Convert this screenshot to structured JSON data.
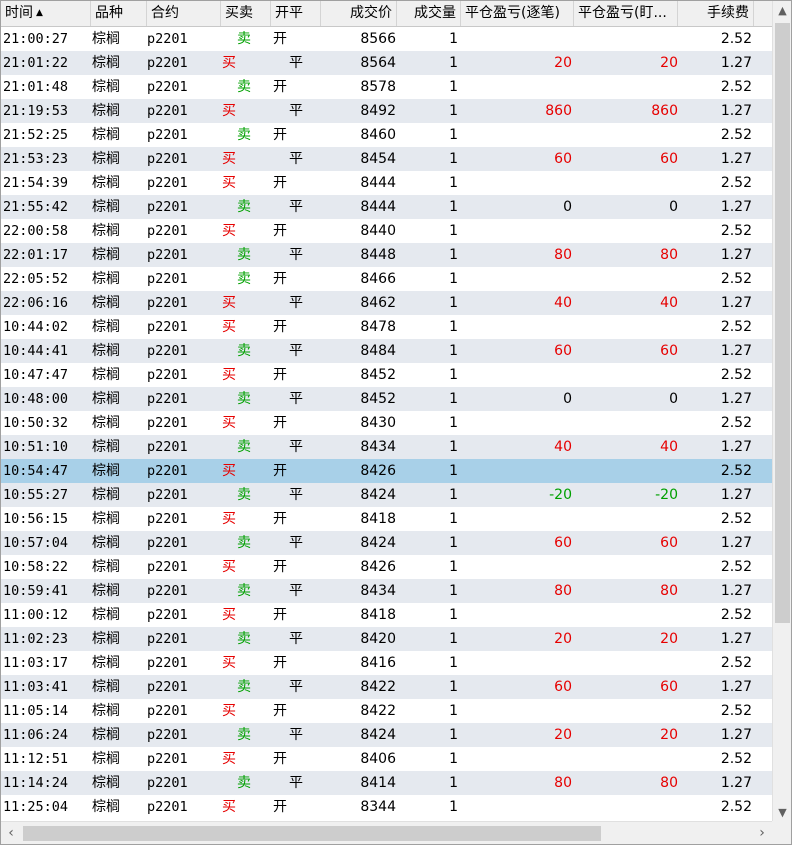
{
  "columns": {
    "time": "时间",
    "variety": "品种",
    "contract": "合约",
    "buysell": "买卖",
    "openclose": "开平",
    "price": "成交价",
    "qty": "成交量",
    "pnl_trade": "平仓盈亏(逐笔)",
    "pnl_mark": "平仓盈亏(盯...",
    "fee": "手续费"
  },
  "sort_icon": "▲",
  "colors": {
    "buy": "#e60000",
    "sell": "#00a000",
    "selected_row": "#a8d0e8",
    "alt_row": "#e5e9ef"
  },
  "selected_index": 18,
  "rows": [
    {
      "time": "21:00:27",
      "variety": "棕榈",
      "contract": "p2201",
      "bs": "卖",
      "oc": "开",
      "price": "8566",
      "qty": "1",
      "pnl1": "",
      "pnl2": "",
      "fee": "2.52"
    },
    {
      "time": "21:01:22",
      "variety": "棕榈",
      "contract": "p2201",
      "bs": "买",
      "oc": "平",
      "price": "8564",
      "qty": "1",
      "pnl1": "20",
      "pnl2": "20",
      "fee": "1.27"
    },
    {
      "time": "21:01:48",
      "variety": "棕榈",
      "contract": "p2201",
      "bs": "卖",
      "oc": "开",
      "price": "8578",
      "qty": "1",
      "pnl1": "",
      "pnl2": "",
      "fee": "2.52"
    },
    {
      "time": "21:19:53",
      "variety": "棕榈",
      "contract": "p2201",
      "bs": "买",
      "oc": "平",
      "price": "8492",
      "qty": "1",
      "pnl1": "860",
      "pnl2": "860",
      "fee": "1.27"
    },
    {
      "time": "21:52:25",
      "variety": "棕榈",
      "contract": "p2201",
      "bs": "卖",
      "oc": "开",
      "price": "8460",
      "qty": "1",
      "pnl1": "",
      "pnl2": "",
      "fee": "2.52"
    },
    {
      "time": "21:53:23",
      "variety": "棕榈",
      "contract": "p2201",
      "bs": "买",
      "oc": "平",
      "price": "8454",
      "qty": "1",
      "pnl1": "60",
      "pnl2": "60",
      "fee": "1.27"
    },
    {
      "time": "21:54:39",
      "variety": "棕榈",
      "contract": "p2201",
      "bs": "买",
      "oc": "开",
      "price": "8444",
      "qty": "1",
      "pnl1": "",
      "pnl2": "",
      "fee": "2.52"
    },
    {
      "time": "21:55:42",
      "variety": "棕榈",
      "contract": "p2201",
      "bs": "卖",
      "oc": "平",
      "price": "8444",
      "qty": "1",
      "pnl1": "0",
      "pnl2": "0",
      "fee": "1.27"
    },
    {
      "time": "22:00:58",
      "variety": "棕榈",
      "contract": "p2201",
      "bs": "买",
      "oc": "开",
      "price": "8440",
      "qty": "1",
      "pnl1": "",
      "pnl2": "",
      "fee": "2.52"
    },
    {
      "time": "22:01:17",
      "variety": "棕榈",
      "contract": "p2201",
      "bs": "卖",
      "oc": "平",
      "price": "8448",
      "qty": "1",
      "pnl1": "80",
      "pnl2": "80",
      "fee": "1.27"
    },
    {
      "time": "22:05:52",
      "variety": "棕榈",
      "contract": "p2201",
      "bs": "卖",
      "oc": "开",
      "price": "8466",
      "qty": "1",
      "pnl1": "",
      "pnl2": "",
      "fee": "2.52"
    },
    {
      "time": "22:06:16",
      "variety": "棕榈",
      "contract": "p2201",
      "bs": "买",
      "oc": "平",
      "price": "8462",
      "qty": "1",
      "pnl1": "40",
      "pnl2": "40",
      "fee": "1.27"
    },
    {
      "time": "10:44:02",
      "variety": "棕榈",
      "contract": "p2201",
      "bs": "买",
      "oc": "开",
      "price": "8478",
      "qty": "1",
      "pnl1": "",
      "pnl2": "",
      "fee": "2.52"
    },
    {
      "time": "10:44:41",
      "variety": "棕榈",
      "contract": "p2201",
      "bs": "卖",
      "oc": "平",
      "price": "8484",
      "qty": "1",
      "pnl1": "60",
      "pnl2": "60",
      "fee": "1.27"
    },
    {
      "time": "10:47:47",
      "variety": "棕榈",
      "contract": "p2201",
      "bs": "买",
      "oc": "开",
      "price": "8452",
      "qty": "1",
      "pnl1": "",
      "pnl2": "",
      "fee": "2.52"
    },
    {
      "time": "10:48:00",
      "variety": "棕榈",
      "contract": "p2201",
      "bs": "卖",
      "oc": "平",
      "price": "8452",
      "qty": "1",
      "pnl1": "0",
      "pnl2": "0",
      "fee": "1.27"
    },
    {
      "time": "10:50:32",
      "variety": "棕榈",
      "contract": "p2201",
      "bs": "买",
      "oc": "开",
      "price": "8430",
      "qty": "1",
      "pnl1": "",
      "pnl2": "",
      "fee": "2.52"
    },
    {
      "time": "10:51:10",
      "variety": "棕榈",
      "contract": "p2201",
      "bs": "卖",
      "oc": "平",
      "price": "8434",
      "qty": "1",
      "pnl1": "40",
      "pnl2": "40",
      "fee": "1.27"
    },
    {
      "time": "10:54:47",
      "variety": "棕榈",
      "contract": "p2201",
      "bs": "买",
      "oc": "开",
      "price": "8426",
      "qty": "1",
      "pnl1": "",
      "pnl2": "",
      "fee": "2.52"
    },
    {
      "time": "10:55:27",
      "variety": "棕榈",
      "contract": "p2201",
      "bs": "卖",
      "oc": "平",
      "price": "8424",
      "qty": "1",
      "pnl1": "-20",
      "pnl2": "-20",
      "fee": "1.27"
    },
    {
      "time": "10:56:15",
      "variety": "棕榈",
      "contract": "p2201",
      "bs": "买",
      "oc": "开",
      "price": "8418",
      "qty": "1",
      "pnl1": "",
      "pnl2": "",
      "fee": "2.52"
    },
    {
      "time": "10:57:04",
      "variety": "棕榈",
      "contract": "p2201",
      "bs": "卖",
      "oc": "平",
      "price": "8424",
      "qty": "1",
      "pnl1": "60",
      "pnl2": "60",
      "fee": "1.27"
    },
    {
      "time": "10:58:22",
      "variety": "棕榈",
      "contract": "p2201",
      "bs": "买",
      "oc": "开",
      "price": "8426",
      "qty": "1",
      "pnl1": "",
      "pnl2": "",
      "fee": "2.52"
    },
    {
      "time": "10:59:41",
      "variety": "棕榈",
      "contract": "p2201",
      "bs": "卖",
      "oc": "平",
      "price": "8434",
      "qty": "1",
      "pnl1": "80",
      "pnl2": "80",
      "fee": "1.27"
    },
    {
      "time": "11:00:12",
      "variety": "棕榈",
      "contract": "p2201",
      "bs": "买",
      "oc": "开",
      "price": "8418",
      "qty": "1",
      "pnl1": "",
      "pnl2": "",
      "fee": "2.52"
    },
    {
      "time": "11:02:23",
      "variety": "棕榈",
      "contract": "p2201",
      "bs": "卖",
      "oc": "平",
      "price": "8420",
      "qty": "1",
      "pnl1": "20",
      "pnl2": "20",
      "fee": "1.27"
    },
    {
      "time": "11:03:17",
      "variety": "棕榈",
      "contract": "p2201",
      "bs": "买",
      "oc": "开",
      "price": "8416",
      "qty": "1",
      "pnl1": "",
      "pnl2": "",
      "fee": "2.52"
    },
    {
      "time": "11:03:41",
      "variety": "棕榈",
      "contract": "p2201",
      "bs": "卖",
      "oc": "平",
      "price": "8422",
      "qty": "1",
      "pnl1": "60",
      "pnl2": "60",
      "fee": "1.27"
    },
    {
      "time": "11:05:14",
      "variety": "棕榈",
      "contract": "p2201",
      "bs": "买",
      "oc": "开",
      "price": "8422",
      "qty": "1",
      "pnl1": "",
      "pnl2": "",
      "fee": "2.52"
    },
    {
      "time": "11:06:24",
      "variety": "棕榈",
      "contract": "p2201",
      "bs": "卖",
      "oc": "平",
      "price": "8424",
      "qty": "1",
      "pnl1": "20",
      "pnl2": "20",
      "fee": "1.27"
    },
    {
      "time": "11:12:51",
      "variety": "棕榈",
      "contract": "p2201",
      "bs": "买",
      "oc": "开",
      "price": "8406",
      "qty": "1",
      "pnl1": "",
      "pnl2": "",
      "fee": "2.52"
    },
    {
      "time": "11:14:24",
      "variety": "棕榈",
      "contract": "p2201",
      "bs": "卖",
      "oc": "平",
      "price": "8414",
      "qty": "1",
      "pnl1": "80",
      "pnl2": "80",
      "fee": "1.27"
    },
    {
      "time": "11:25:04",
      "variety": "棕榈",
      "contract": "p2201",
      "bs": "买",
      "oc": "开",
      "price": "8344",
      "qty": "1",
      "pnl1": "",
      "pnl2": "",
      "fee": "2.52"
    }
  ]
}
